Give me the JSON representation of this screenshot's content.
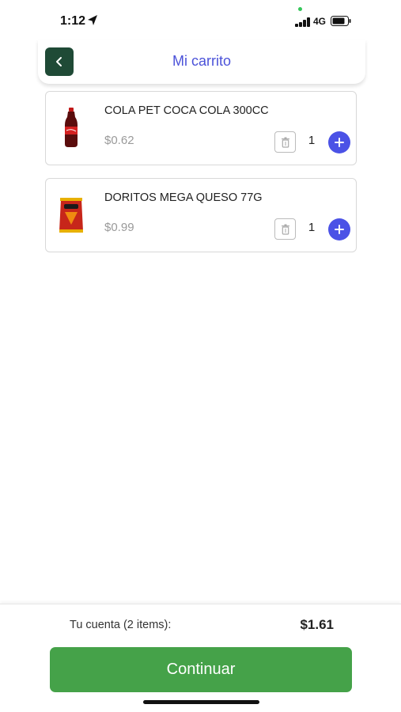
{
  "status_bar": {
    "time": "1:12",
    "network": "4G",
    "location_icon": "location-arrow-icon",
    "signal_icon": "cellular-signal-icon",
    "battery_icon": "battery-icon"
  },
  "header": {
    "title": "Mi carrito",
    "back_icon": "chevron-left-icon"
  },
  "cart": {
    "items": [
      {
        "name": "COLA PET COCA COLA 300CC",
        "price": "$0.62",
        "quantity": "1",
        "image": "coca-cola-bottle"
      },
      {
        "name": "DORITOS MEGA QUESO 77G",
        "price": "$0.99",
        "quantity": "1",
        "image": "doritos-bag"
      }
    ]
  },
  "footer": {
    "total_label": "Tu cuenta (2 items):",
    "total_value": "$1.61",
    "continue_label": "Continuar"
  },
  "colors": {
    "accent": "#4b52e6",
    "back_button": "#1f4a36",
    "continue_button": "#45a249",
    "price_text": "#9a9a9a"
  }
}
